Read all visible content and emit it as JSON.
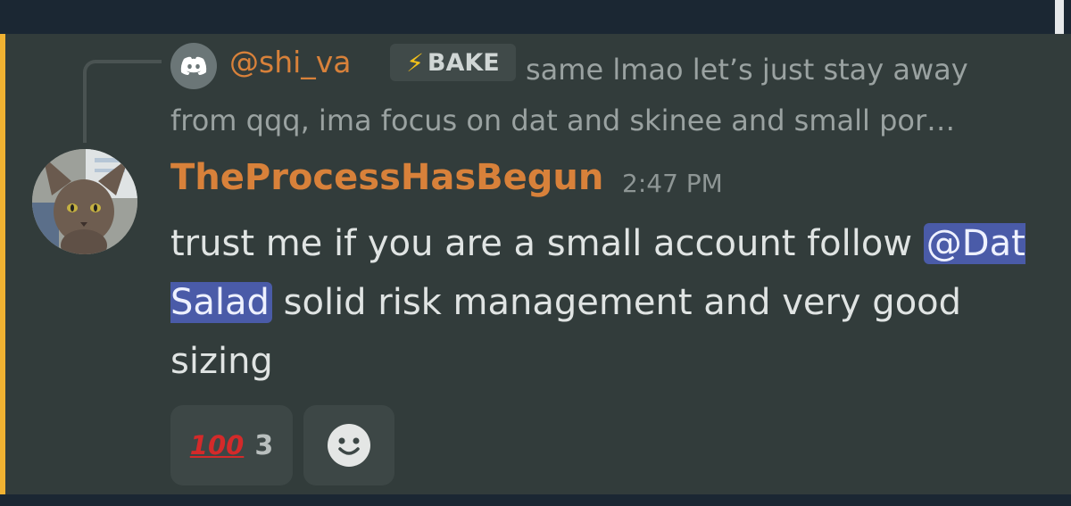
{
  "reply": {
    "author": "@shi_va",
    "tag_icon": "lightning-bolt",
    "tag_label": "BAKE",
    "text": "same lmao let’s just stay away from qqq, ima focus on dat and skinee and small por…"
  },
  "message": {
    "author": "TheProcessHasBegun",
    "timestamp": "2:47 PM",
    "text_before": "trust me if you are a small account follow ",
    "mention": "@Dat Salad",
    "text_after": " solid risk management and very good sizing"
  },
  "reactions": [
    {
      "emoji": "💯",
      "count": "3"
    }
  ],
  "colors": {
    "accent_bar": "#f0b232",
    "author": "#d8813a",
    "mention_bg": "#4a5ba8",
    "tag_bolt": "#f2c01a"
  }
}
